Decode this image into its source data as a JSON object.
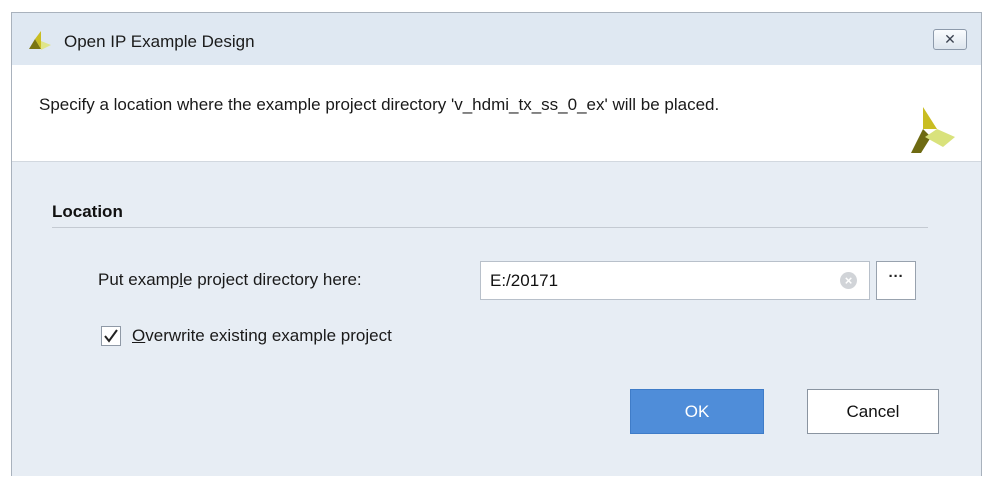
{
  "window": {
    "title": "Open IP Example Design",
    "close_symbol": "✕",
    "logo_icon": "xilinx-logo-icon"
  },
  "header": {
    "description": "Specify a location where the example project directory 'v_hdmi_tx_ss_0_ex' will be placed.",
    "logo_icon": "xilinx-logo-icon"
  },
  "location": {
    "section_title": "Location",
    "dir_label_before": "Put examp",
    "dir_label_mnemonic": "l",
    "dir_label_after": "e project directory here:",
    "dir_value": "E:/20171",
    "clear_symbol": "×",
    "browse_label": "···",
    "overwrite_checked": true,
    "overwrite_label_mnemonic": "O",
    "overwrite_label_rest": "verwrite existing example project"
  },
  "buttons": {
    "ok_label": "OK",
    "cancel_label": "Cancel"
  },
  "colors": {
    "logo_dark": "#6e6a12",
    "logo_light": "#d9e27c",
    "primary_button": "#4f8dd9"
  }
}
